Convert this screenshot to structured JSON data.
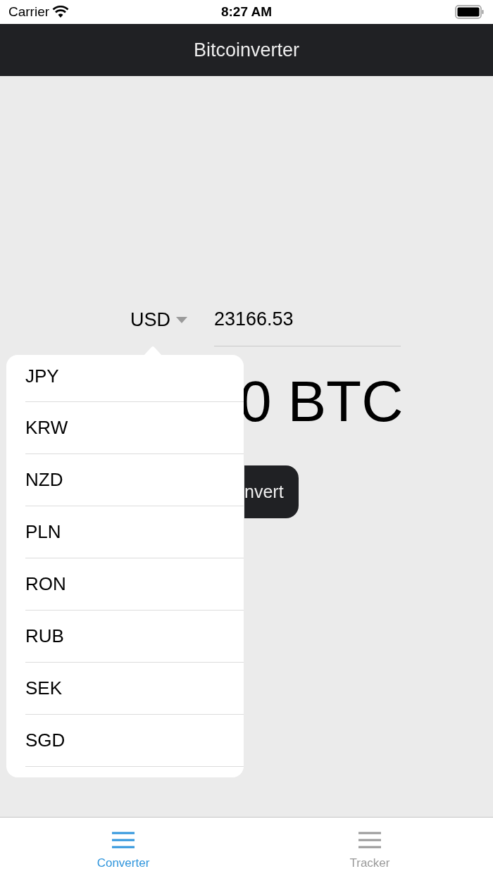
{
  "status_bar": {
    "carrier": "Carrier",
    "time": "8:27 AM"
  },
  "nav_bar": {
    "title": "Bitcoinverter"
  },
  "converter": {
    "currency": "USD",
    "expanded": true,
    "amount": "23166.53",
    "result": "0 BTC",
    "button": "nvert"
  },
  "dropdown": {
    "options": [
      {
        "label": "JPY"
      },
      {
        "label": "KRW"
      },
      {
        "label": "NZD"
      },
      {
        "label": "PLN"
      },
      {
        "label": "RON"
      },
      {
        "label": "RUB"
      },
      {
        "label": "SEK"
      },
      {
        "label": "SGD"
      }
    ]
  },
  "tab_bar": [
    {
      "label": "Converter",
      "selected": true
    },
    {
      "label": "Tracker",
      "selected": false
    }
  ]
}
